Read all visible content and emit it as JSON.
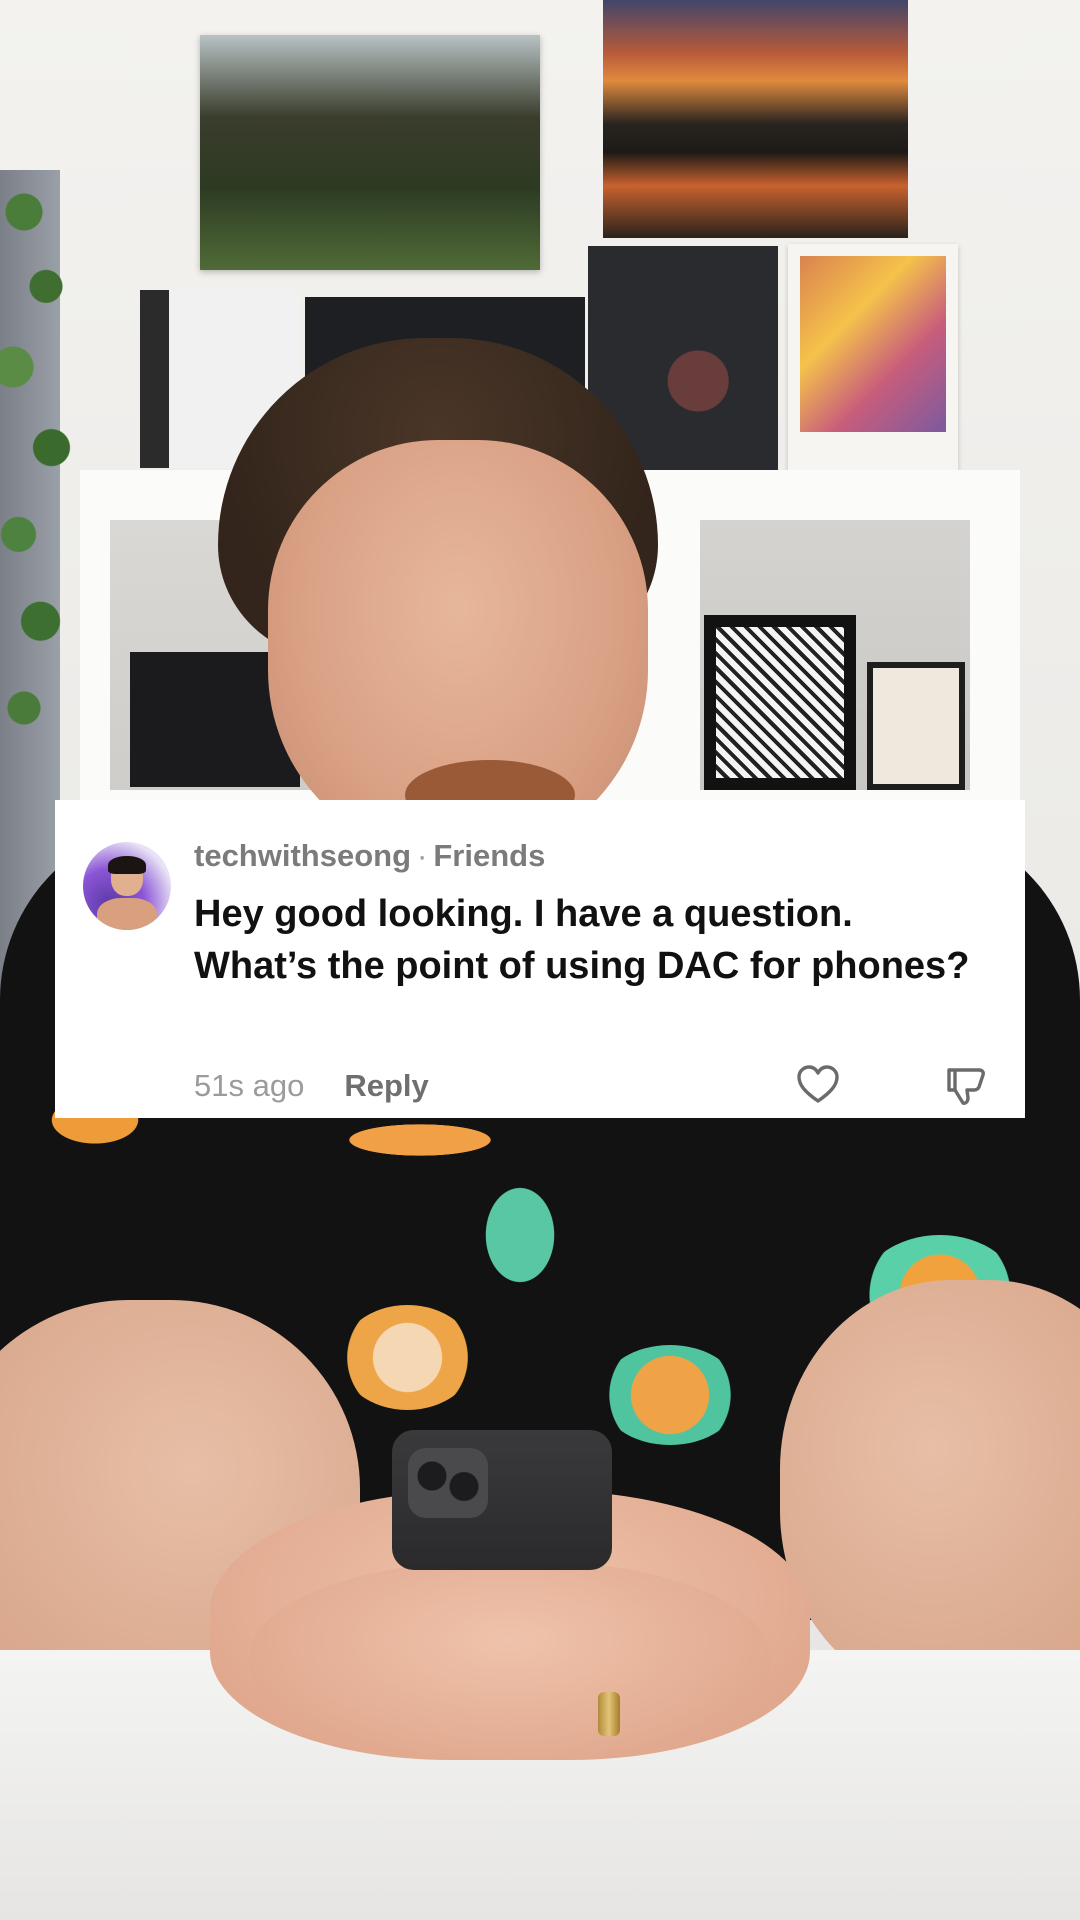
{
  "comment": {
    "username": "techwithseong",
    "separator": "·",
    "relationship": "Friends",
    "text": "Hey good looking. I have a question. What’s the point of using DAC for phones?",
    "time_ago": "51s ago",
    "reply_label": "Reply",
    "avatar_icon": "profile-avatar",
    "like_icon": "heart-outline-icon",
    "dislike_icon": "thumbs-down-outline-icon"
  }
}
